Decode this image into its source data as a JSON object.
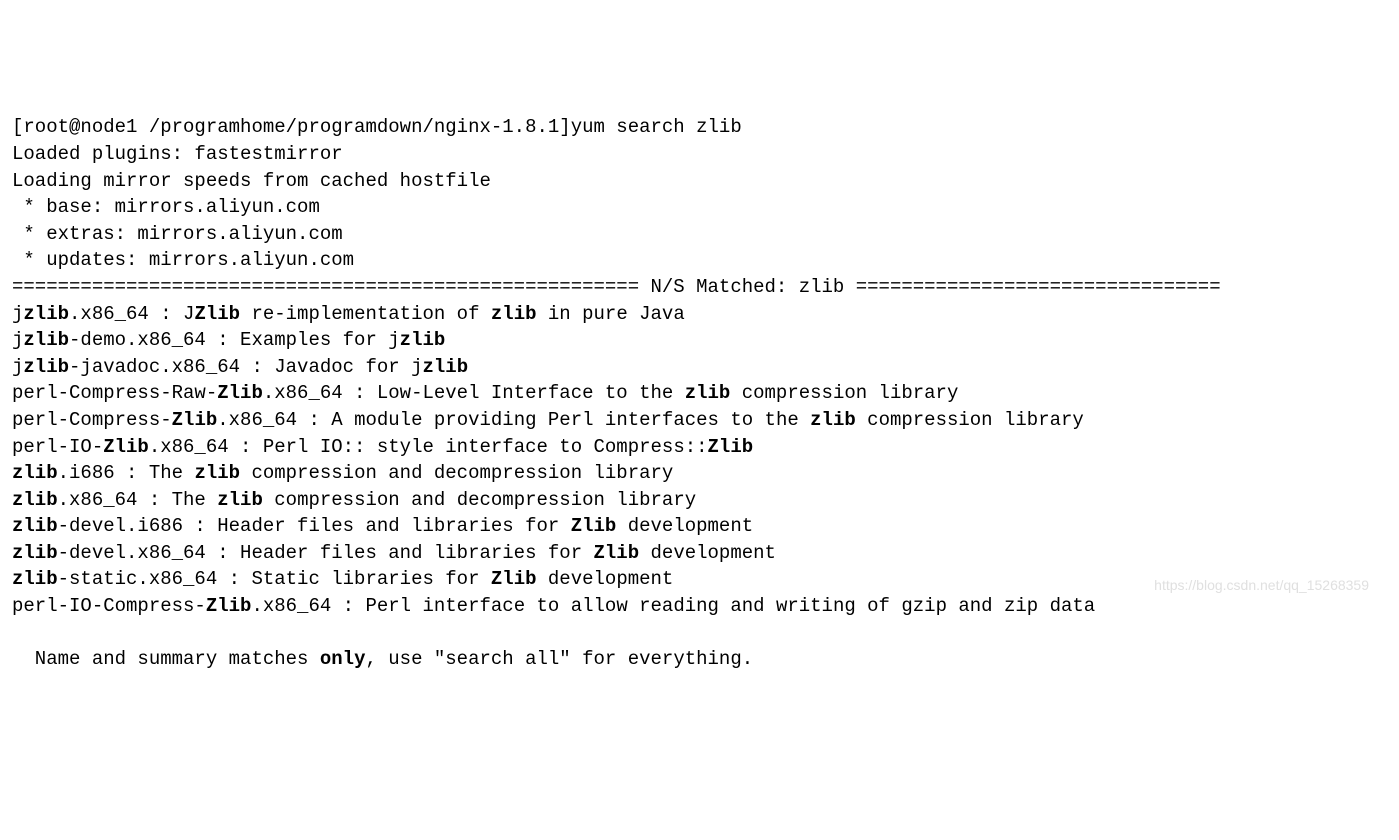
{
  "prompt": {
    "user_host": "[root@node1 ",
    "path": "/programhome/programdown/nginx-1.8.1]",
    "command": "yum search zlib"
  },
  "header": {
    "l1": "Loaded plugins: fastestmirror",
    "l2": "Loading mirror speeds from cached hostfile",
    "l3": " * base: mirrors.aliyun.com",
    "l4": " * extras: mirrors.aliyun.com",
    "l5": " * updates: mirrors.aliyun.com"
  },
  "section": {
    "left": "======================================================= ",
    "label": "N/S Matched: zlib",
    "right": " ================================"
  },
  "results": [
    {
      "pre": "j",
      "b1": "zlib",
      "mid": ".x86_64 : J",
      "b2": "Zlib",
      "mid2": " re-implementation of ",
      "b3": "zlib",
      "post": " in pure Java"
    },
    {
      "pre": "j",
      "b1": "zlib",
      "mid": "-demo.x86_64 : Examples for j",
      "b2": "zlib",
      "mid2": "",
      "b3": "",
      "post": ""
    },
    {
      "pre": "j",
      "b1": "zlib",
      "mid": "-javadoc.x86_64 : Javadoc for j",
      "b2": "zlib",
      "mid2": "",
      "b3": "",
      "post": ""
    },
    {
      "pre": "perl-Compress-Raw-",
      "b1": "Zlib",
      "mid": ".x86_64 : Low-Level Interface to the ",
      "b2": "zlib",
      "mid2": " compression library",
      "b3": "",
      "post": ""
    },
    {
      "pre": "perl-Compress-",
      "b1": "Zlib",
      "mid": ".x86_64 : A module providing Perl interfaces to the ",
      "b2": "zlib",
      "mid2": " compression library",
      "b3": "",
      "post": ""
    },
    {
      "pre": "perl-IO-",
      "b1": "Zlib",
      "mid": ".x86_64 : Perl IO:: style interface to Compress::",
      "b2": "Zlib",
      "mid2": "",
      "b3": "",
      "post": ""
    },
    {
      "pre": "",
      "b1": "zlib",
      "mid": ".i686 : The ",
      "b2": "zlib",
      "mid2": " compression and decompression library",
      "b3": "",
      "post": ""
    },
    {
      "pre": "",
      "b1": "zlib",
      "mid": ".x86_64 : The ",
      "b2": "zlib",
      "mid2": " compression and decompression library",
      "b3": "",
      "post": ""
    },
    {
      "pre": "",
      "b1": "zlib",
      "mid": "-devel.i686 : Header files and libraries for ",
      "b2": "Zlib",
      "mid2": " development",
      "b3": "",
      "post": ""
    },
    {
      "pre": "",
      "b1": "zlib",
      "mid": "-devel.x86_64 : Header files and libraries for ",
      "b2": "Zlib",
      "mid2": " development",
      "b3": "",
      "post": ""
    },
    {
      "pre": "",
      "b1": "zlib",
      "mid": "-static.x86_64 : Static libraries for ",
      "b2": "Zlib",
      "mid2": " development",
      "b3": "",
      "post": ""
    },
    {
      "pre": "perl-IO-Compress-",
      "b1": "Zlib",
      "mid": ".x86_64 : Perl interface to allow reading and writing of gzip and zip data",
      "b2": "",
      "mid2": "",
      "b3": "",
      "post": ""
    }
  ],
  "footer": {
    "pre": "  Name and summary matches ",
    "b": "only",
    "post": ", use \"search all\" for everything."
  },
  "watermark": "https://blog.csdn.net/qq_15268359"
}
